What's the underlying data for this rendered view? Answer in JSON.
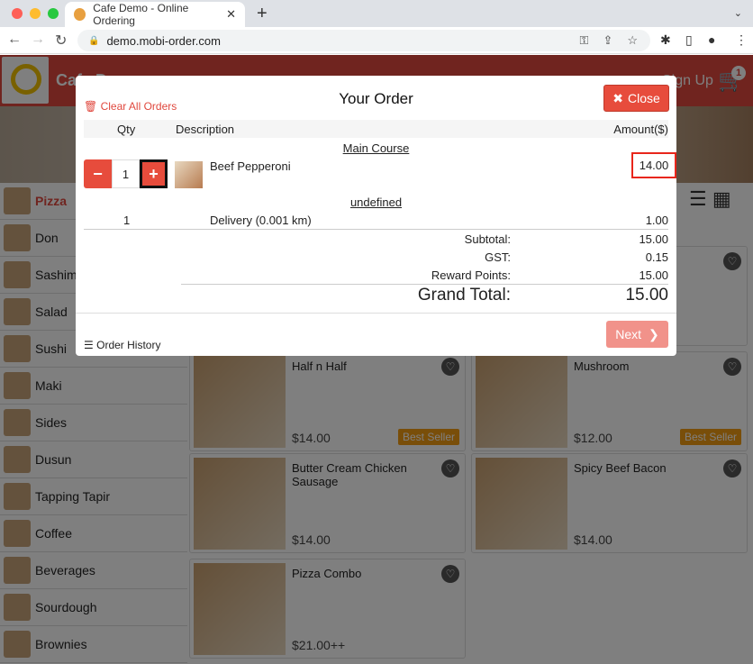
{
  "browser": {
    "tab_title": "Cafe Demo - Online Ordering",
    "url": "demo.mobi-order.com"
  },
  "header": {
    "name": "Cafe Demo",
    "signup": "Sign Up",
    "cart_count": "1"
  },
  "sidebar": {
    "items": [
      {
        "label": "Pizza",
        "active": true
      },
      {
        "label": "Don"
      },
      {
        "label": "Sashimi"
      },
      {
        "label": "Salad"
      },
      {
        "label": "Sushi"
      },
      {
        "label": "Maki"
      },
      {
        "label": "Sides"
      },
      {
        "label": "Dusun"
      },
      {
        "label": "Tapping Tapir"
      },
      {
        "label": "Coffee"
      },
      {
        "label": "Beverages"
      },
      {
        "label": "Sourdough"
      },
      {
        "label": "Brownies"
      }
    ]
  },
  "products": [
    {
      "name": "Half n Half",
      "price": "$14.00",
      "badge": "Best Seller"
    },
    {
      "name": "Mushroom",
      "price": "$12.00",
      "badge": "Best Seller"
    },
    {
      "name": "Butter Cream Chicken Sausage",
      "price": "$14.00"
    },
    {
      "name": "Spicy Beef Bacon",
      "price": "$14.00"
    },
    {
      "name": "Pizza Combo",
      "price": "$21.00++"
    }
  ],
  "modal": {
    "title": "Your Order",
    "clear": "Clear All Orders",
    "close": "Close",
    "col_qty": "Qty",
    "col_desc": "Description",
    "col_amount": "Amount($)",
    "section1": "Main Course",
    "item": {
      "qty": "1",
      "name": "Beef Pepperoni",
      "amount": "14.00"
    },
    "section2": "undefined",
    "delivery": {
      "qty": "1",
      "name": "Delivery (0.001 km)",
      "amount": "1.00"
    },
    "subtotal_label": "Subtotal:",
    "subtotal": "15.00",
    "gst_label": "GST:",
    "gst": "0.15",
    "reward_label": "Reward Points:",
    "reward": "15.00",
    "grand_label": "Grand Total:",
    "grand": "15.00",
    "next": "Next",
    "history": "Order History"
  },
  "colors": {
    "accent": "#e74c3c",
    "highlight": "#e8261b"
  }
}
